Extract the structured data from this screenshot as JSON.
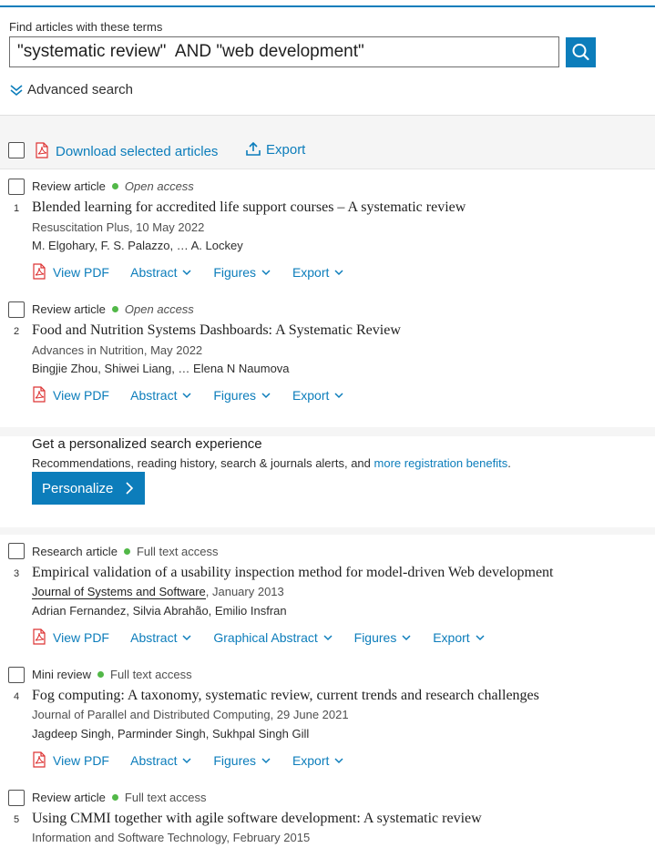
{
  "search": {
    "label": "Find articles with these terms",
    "query": "\"systematic review\"  AND \"web development\"",
    "advanced_label": "Advanced search"
  },
  "toolbar": {
    "download_label": "Download selected articles",
    "export_label": "Export"
  },
  "articles": [
    {
      "number": "1",
      "type": "Review article",
      "access": "Open access",
      "title": "Blended learning for accredited life support courses – A systematic review",
      "source": "Resuscitation Plus, 10 May 2022",
      "authors": "M. Elgohary, F. S. Palazzo, … A. Lockey",
      "actions": [
        "View PDF",
        "Abstract",
        "Figures",
        "Export"
      ]
    },
    {
      "number": "2",
      "type": "Review article",
      "access": "Open access",
      "title": "Food and Nutrition Systems Dashboards: A Systematic Review",
      "source": "Advances in Nutrition, May 2022",
      "authors": "Bingjie Zhou, Shiwei Liang, … Elena N Naumova",
      "actions": [
        "View PDF",
        "Abstract",
        "Figures",
        "Export"
      ]
    },
    {
      "number": "3",
      "type": "Research article",
      "access": "Full text access",
      "title": "Empirical validation of a usability inspection method for model-driven Web development",
      "source_journal": "Journal of Systems and Software",
      "source_date": ", January 2013",
      "authors": "Adrian Fernandez, Silvia Abrahão, Emilio Insfran",
      "actions": [
        "View PDF",
        "Abstract",
        "Graphical Abstract",
        "Figures",
        "Export"
      ]
    },
    {
      "number": "4",
      "type": "Mini review",
      "access": "Full text access",
      "title": "Fog computing: A taxonomy, systematic review, current trends and research challenges",
      "source": "Journal of Parallel and Distributed Computing, 29 June 2021",
      "authors": "Jagdeep Singh, Parminder Singh, Sukhpal Singh Gill",
      "actions": [
        "View PDF",
        "Abstract",
        "Figures",
        "Export"
      ]
    },
    {
      "number": "5",
      "type": "Review article",
      "access": "Full text access",
      "title": "Using CMMI together with agile software development: A systematic review",
      "source": "Information and Software Technology, February 2015",
      "authors": "",
      "actions": []
    }
  ],
  "promo": {
    "title": "Get a personalized search experience",
    "subtitle_prefix": "Recommendations, reading history, search & journals alerts, and ",
    "subtitle_link": "more registration benefits",
    "subtitle_suffix": ".",
    "button_label": "Personalize"
  },
  "colors": {
    "accent": "#0c7dbb",
    "open_access_dot": "#52b848",
    "results_bg": "#f5f5f5"
  }
}
